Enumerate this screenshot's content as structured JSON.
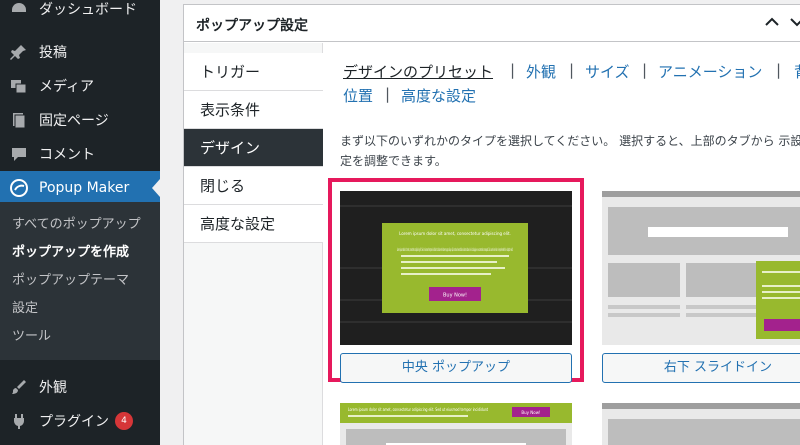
{
  "sidebar": {
    "dashboard_label": "ダッシュボード",
    "posts_label": "投稿",
    "media_label": "メディア",
    "pages_label": "固定ページ",
    "comments_label": "コメント",
    "popup_maker_label": "Popup Maker",
    "submenu": {
      "all_popups": "すべてのポップアップ",
      "add_popup": "ポップアップを作成",
      "popup_themes": "ポップアップテーマ",
      "settings": "設定",
      "tools": "ツール"
    },
    "appearance_label": "外観",
    "plugins_label": "プラグイン",
    "plugins_badge": "4"
  },
  "postbox": {
    "title": "ポップアップ設定"
  },
  "vertical_tabs": [
    "トリガー",
    "表示条件",
    "デザイン",
    "閉じる",
    "高度な設定"
  ],
  "subtabs": {
    "presets": "デザインのプリセット",
    "appearance": "外観",
    "size": "サイズ",
    "animation": "アニメーション",
    "cut": "背",
    "position": "位置",
    "advanced": "高度な設定",
    "separator": "|"
  },
  "description": "まず以下のいずれかのタイプを選択してください。 選択すると、上部のタブから 示設定を調整できます。",
  "preview": {
    "lorem_title": "Lorem ipsum dolor sit amet, consectetur adipiscing elit.",
    "lorem_body": "Lorem ipsum dolor sit amet, consectetur adipiscing elit. Sed ut eiusmod tempor incididunt ut labore et dolore magna aliqua. Quis nostrud exercitation ullamco laboris nisi ut aliquip ex ea commodo consequat. Duis aute irure dolor in reprehenderit in voluptate velit.",
    "buy_now": "Buy Now!",
    "bar_text": "Lorem ipsum dolor sit amet, consectetur adipiscing elit. Sed ut eiusmod tempor incididunt"
  },
  "presets": [
    {
      "label": "中央 ポップアップ"
    },
    {
      "label": "右下 スライドイン"
    }
  ],
  "colors": {
    "sidebar_bg": "#1d2327",
    "active_blue": "#2271b1",
    "highlight_pink": "#e6195c",
    "preset_green": "#98b92e",
    "button_purple": "#a3228d"
  }
}
